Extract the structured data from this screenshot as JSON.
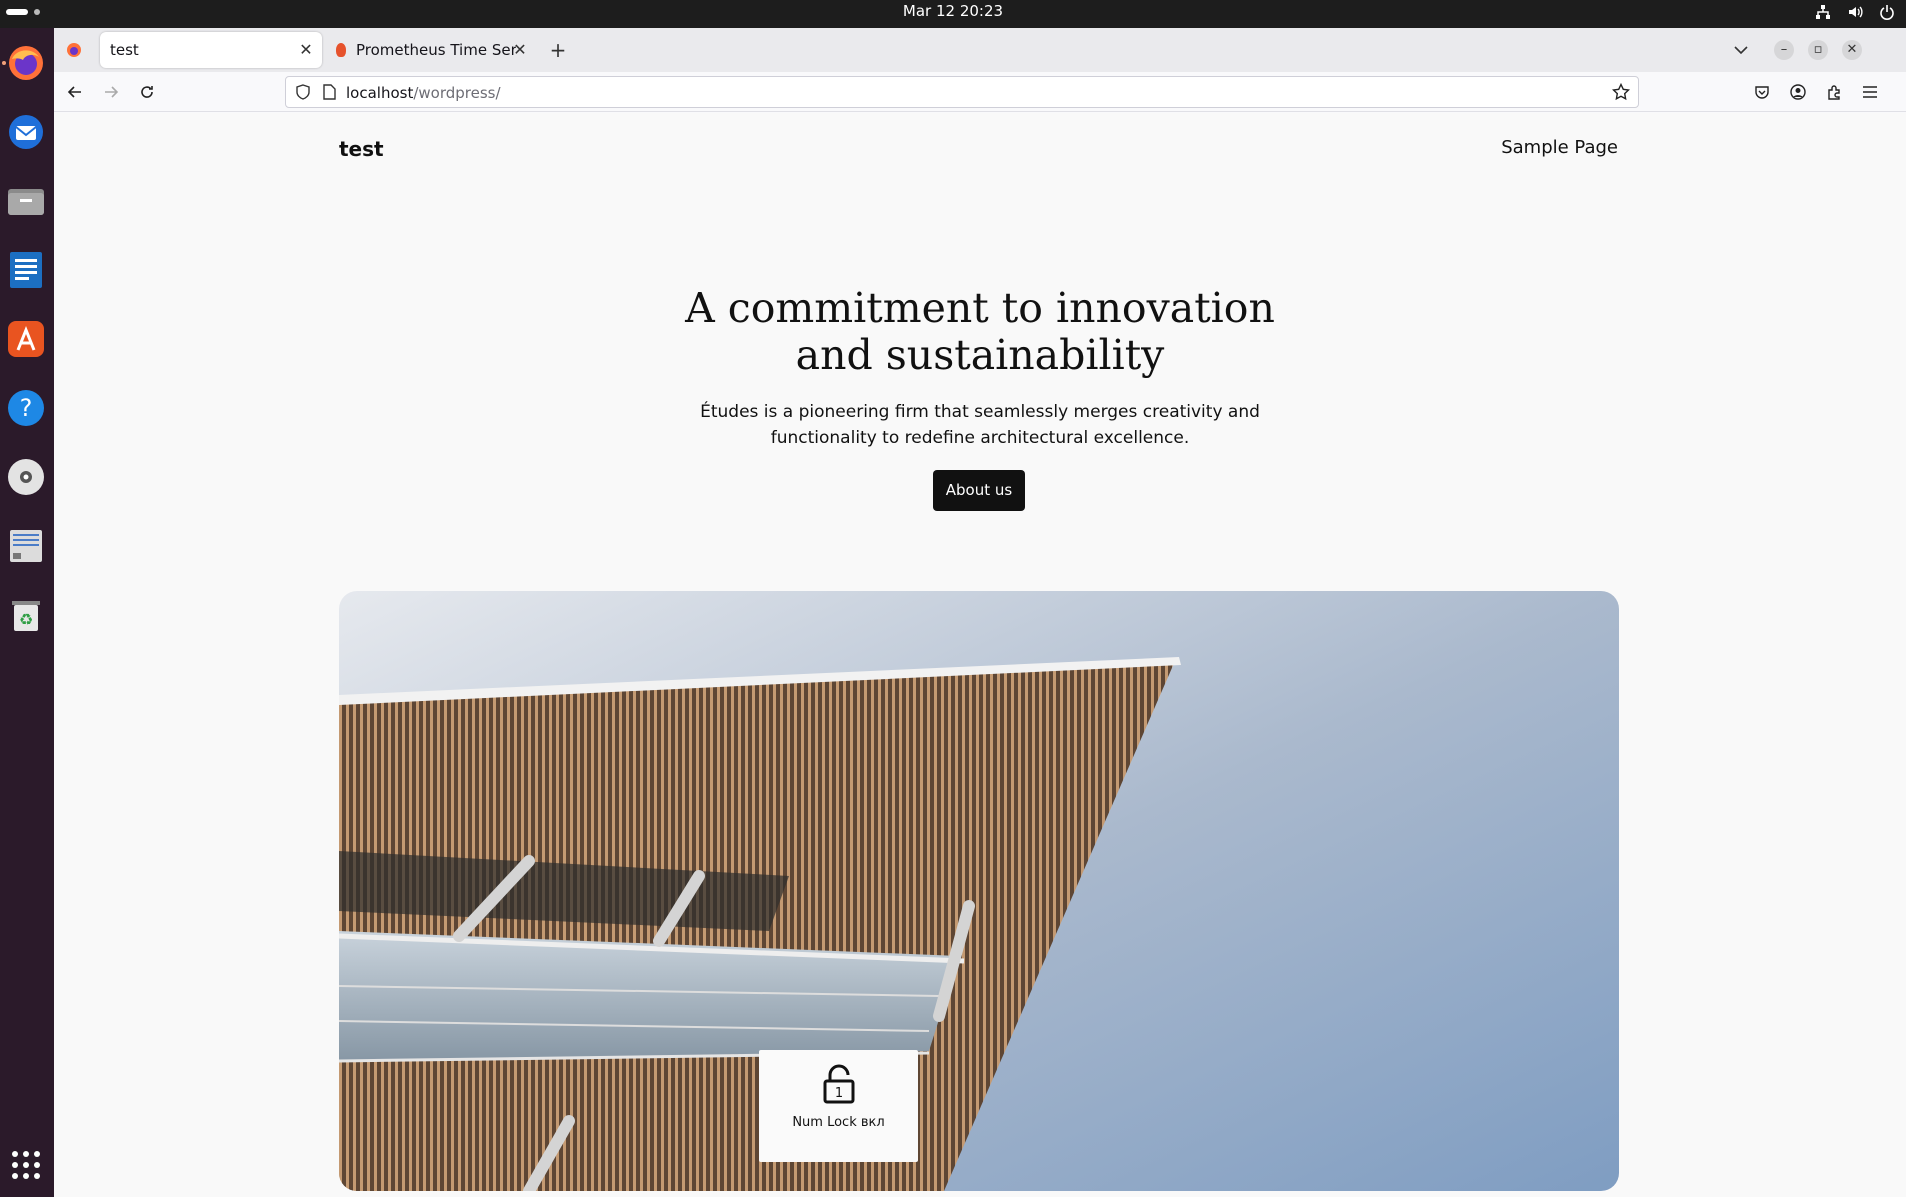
{
  "system": {
    "clock": "Mar 12  20:23",
    "tray_icons": [
      "network-icon",
      "volume-icon",
      "power-icon"
    ]
  },
  "dock": {
    "apps": [
      {
        "name": "firefox-icon",
        "running": true
      },
      {
        "name": "thunderbird-icon",
        "running": false
      },
      {
        "name": "files-icon",
        "running": false
      },
      {
        "name": "writer-icon",
        "running": false
      },
      {
        "name": "app-center-icon",
        "running": false
      },
      {
        "name": "help-icon",
        "running": false
      },
      {
        "name": "disc-icon",
        "running": false
      },
      {
        "name": "drive-icon",
        "running": false
      },
      {
        "name": "trash-icon",
        "running": false
      },
      {
        "name": "show-apps-icon",
        "running": false
      }
    ]
  },
  "browser": {
    "tabs": [
      {
        "title": "test",
        "active": true
      },
      {
        "title": "Prometheus Time Series C",
        "active": false
      }
    ],
    "url_host": "localhost",
    "url_path": "/wordpress/"
  },
  "page": {
    "site_title": "test",
    "nav_link": "Sample Page",
    "hero_title_line1": "A commitment to innovation",
    "hero_title_line2": "and sustainability",
    "hero_sub_line1": "Études is a pioneering firm that seamlessly merges creativity and",
    "hero_sub_line2": "functionality to redefine architectural excellence.",
    "cta_label": "About us"
  },
  "osd": {
    "label": "Num Lock вкл",
    "digit": "1"
  }
}
